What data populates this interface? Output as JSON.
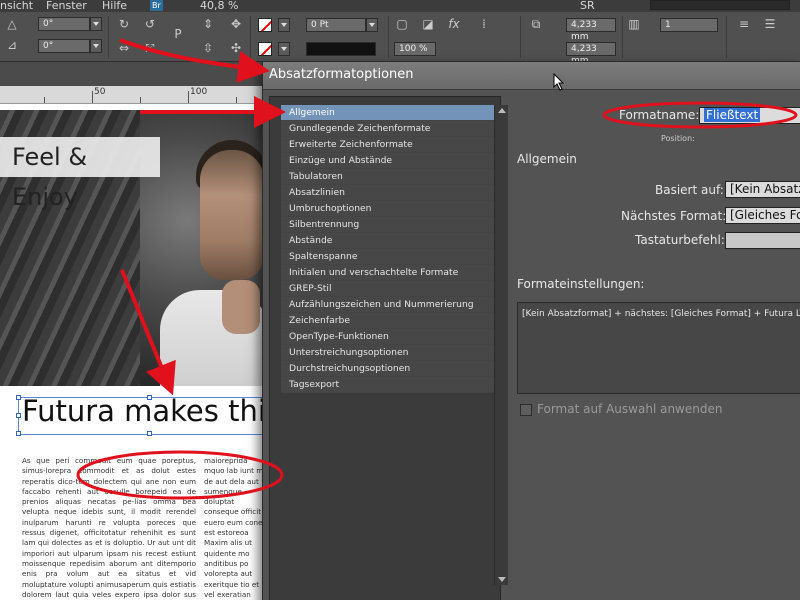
{
  "menubar": {
    "items": [
      "nsicht",
      "Fenster",
      "Hilfe"
    ],
    "br_badge": "Br",
    "zoom": "40,8 %",
    "workspace": "SR"
  },
  "control_panel": {
    "angle_1": "0°",
    "angle_2": "0°",
    "stroke_weight": "0 Pt",
    "percent": "100 %",
    "measure_1": "4,233 mm",
    "measure_2": "4,233 mm",
    "columns": "1",
    "fx_label": "fx"
  },
  "ruler": {
    "marks": [
      "50",
      "100"
    ]
  },
  "document": {
    "banner": "Feel & Enjoy",
    "headline": "Futura makes thing",
    "body_col1": "As que peri commodit eum quae poreptus, simus-lorepra commodit et as dolut estes reperatis dico-tem dolectem qui ane non eum faccabo rehenti aut acculle borepeid ea de prenios aliquas necatas pe-lias omma bea velupta neque idebis sunt, il modit rerendel inulparum harunti re volupta poreces que ressus digenet, officitotatur rehenihit es sunt lam qui dolectes as et is doluptio. Ur aut unt dit imporiori aut ulparum ipsam nis recest estiunt moissenque repedisim aborum ant ditemporio enis pra volum aut ea sitatus et vid moluptature volupti animusaperum quis estiatis dolorem laut quia veles expero ipsa dolor sus aut maximod quam esserum am, volore, solorenda quae imoluptibus sit dus. Pero volorem, to bla que velicta taquecid eit pi ut suda",
    "body_col2": "maioreprida mquo lab iunt mi de aut dela aut sumenque doluptat conseque officit euero eum cone est estoreoa Maxim alis ut quidente mo anditibus po volorepta aut exeritque tio et vel exeratian adquatis Rum Ellor mulit, simu vit dolorem, adignatem rem hitia nonsequi"
  },
  "dialog": {
    "title": "Absatzformatoptionen",
    "categories": [
      "Allgemein",
      "Grundlegende Zeichenformate",
      "Erweiterte Zeichenformate",
      "Einzüge und Abstände",
      "Tabulatoren",
      "Absatzlinien",
      "Umbruchoptionen",
      "Silbentrennung",
      "Abstände",
      "Spaltenspanne",
      "Initialen und verschachtelte Formate",
      "GREP-Stil",
      "Aufzählungszeichen und Nummerierung",
      "Zeichenfarbe",
      "OpenType-Funktionen",
      "Unterstreichungsoptionen",
      "Durchstreichungsoptionen",
      "Tagsexport"
    ],
    "selected_category": "Allgemein",
    "format_name_label": "Formatname:",
    "format_name_value": "Fließtext",
    "position_label": "Position:",
    "section_title": "Allgemein",
    "based_on_label": "Basiert auf:",
    "based_on_value": "[Kein Absatzfo",
    "next_style_label": "Nächstes Format:",
    "next_style_value": "[Gleiches For",
    "shortcut_label": "Tastaturbefehl:",
    "shortcut_value": "",
    "settings_label": "Formateinstellungen:",
    "settings_value": "[Kein Absatzformat] + nächstes: [Gleiches Format] + Futura LT Pro +",
    "apply_label": "Format auf Auswahl anwenden"
  },
  "colors": {
    "annotation_red": "#e0101c",
    "selection_blue": "#7393b8",
    "dialog_gray": "#535353"
  }
}
